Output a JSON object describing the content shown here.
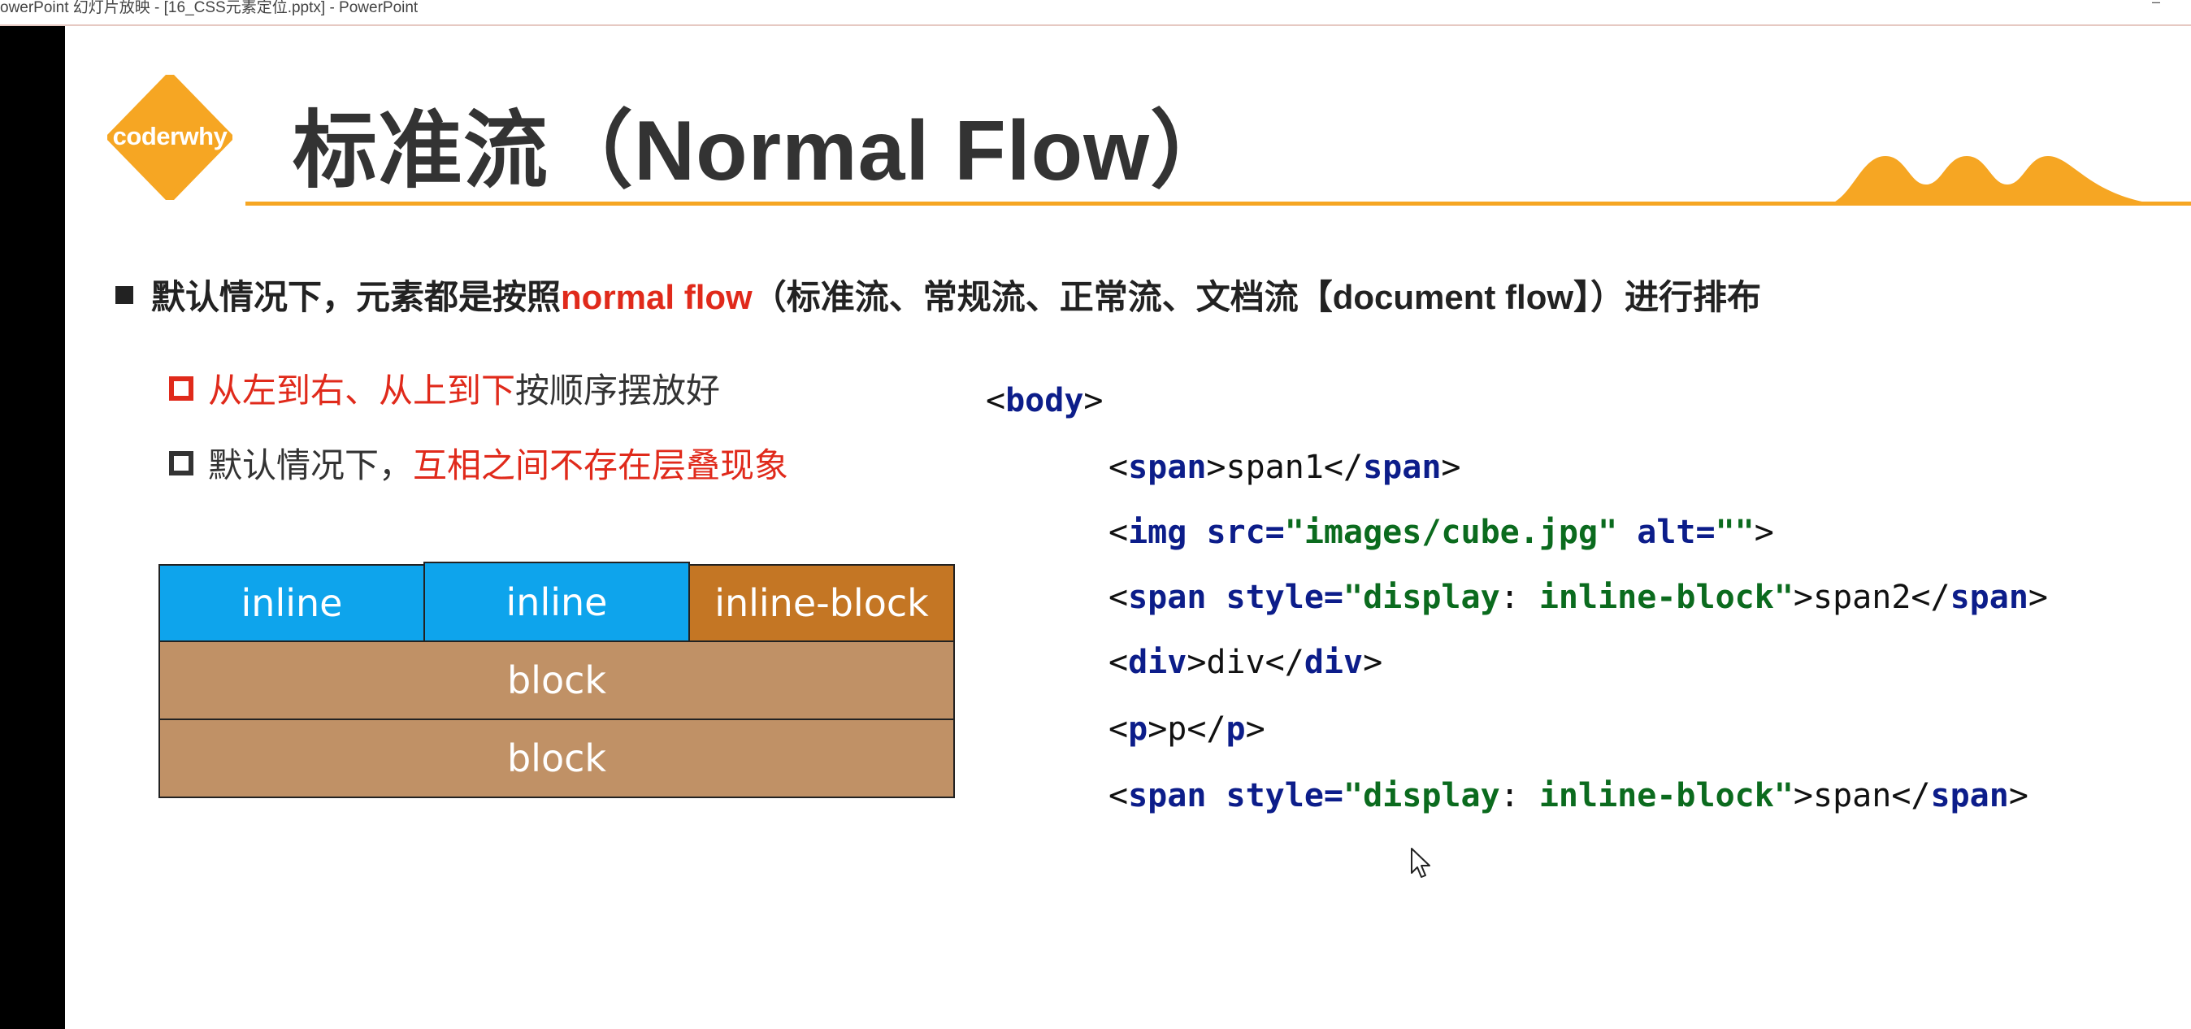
{
  "window": {
    "title": "owerPoint 幻灯片放映 - [16_CSS元素定位.pptx] - PowerPoint",
    "minimize_glyph": "–"
  },
  "slide": {
    "logo_text": "coderwhy",
    "title": "标准流（Normal Flow）",
    "bullet": {
      "part1": "默认情况下，元素都是按照",
      "part2_highlight": "normal flow",
      "part3": "（标准流、常规流、正常流、文档流【document flow】）进行排布"
    },
    "sub1": {
      "highlight": "从左到右、从上到下",
      "rest": "按顺序摆放好"
    },
    "sub2": {
      "plain": "默认情况下，",
      "highlight": "互相之间不存在层叠现象"
    },
    "diagram": {
      "inline1": "inline",
      "inline2": "inline",
      "inline_block": "inline-block",
      "block1": "block",
      "block2": "block"
    },
    "code": {
      "l1": {
        "a": "<",
        "b": "body",
        "c": ">"
      },
      "l2": {
        "a": "<",
        "b": "span",
        "c": ">span1</",
        "d": "span",
        "e": ">"
      },
      "l3": {
        "a": "<",
        "b": "img",
        "c": " ",
        "d": "src=",
        "e": "\"images/cube.jpg\"",
        "f": " ",
        "g": "alt=",
        "h": "\"\"",
        "i": ">"
      },
      "l4": {
        "a": "<",
        "b": "span",
        "c": " ",
        "d": "style=",
        "e": "\"display",
        "f": ": ",
        "g": "inline-block\"",
        "h": ">span2</",
        "i": "span",
        "j": ">"
      },
      "l5": {
        "a": "<",
        "b": "div",
        "c": ">div</",
        "d": "div",
        "e": ">"
      },
      "l6": {
        "a": "<",
        "b": "p",
        "c": ">p</",
        "d": "p",
        "e": ">"
      },
      "l7": {
        "a": "<",
        "b": "span",
        "c": " ",
        "d": "style=",
        "e": "\"display",
        "f": ": ",
        "g": "inline-block\"",
        "h": ">span</",
        "i": "span",
        "j": ">"
      }
    }
  },
  "colors": {
    "accent_orange": "#f6a623",
    "highlight_red": "#e02a1b",
    "inline_blue": "#0ea4ec",
    "inline_block_orange": "#c47624",
    "block_tan": "#c09166"
  }
}
